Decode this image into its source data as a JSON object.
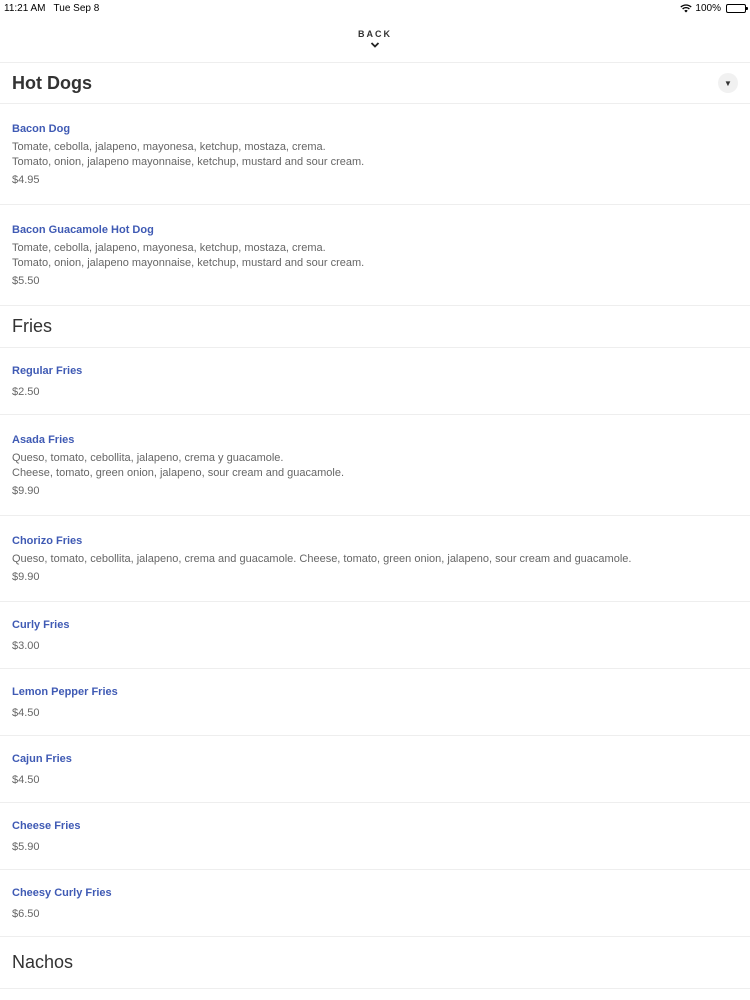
{
  "status": {
    "time": "11:21 AM",
    "date": "Tue Sep 8",
    "battery": "100%"
  },
  "nav": {
    "back_label": "BACK"
  },
  "sections": [
    {
      "title": "Hot Dogs",
      "items": [
        {
          "name": "Bacon Dog",
          "desc": [
            "Tomate, cebolla, jalapeno, mayonesa, ketchup, mostaza, crema.",
            "Tomato, onion, jalapeno mayonnaise, ketchup, mustard and sour cream."
          ],
          "price": "$4.95"
        },
        {
          "name": "Bacon Guacamole Hot Dog",
          "desc": [
            "Tomate, cebolla, jalapeno, mayonesa, ketchup, mostaza, crema.",
            "Tomato, onion, jalapeno mayonnaise, ketchup, mustard and sour cream."
          ],
          "price": "$5.50"
        }
      ]
    },
    {
      "title": "Fries",
      "items": [
        {
          "name": "Regular Fries",
          "price": "$2.50"
        },
        {
          "name": "Asada Fries",
          "desc": [
            "Queso, tomato, cebollita, jalapeno, crema y guacamole.",
            "Cheese, tomato, green onion, jalapeno, sour cream and guacamole."
          ],
          "price": "$9.90"
        },
        {
          "name": "Chorizo Fries",
          "desc": [
            "Queso, tomato, cebollita, jalapeno, crema and guacamole. Cheese, tomato, green onion, jalapeno, sour cream and guacamole."
          ],
          "price": "$9.90"
        },
        {
          "name": "Curly Fries",
          "price": "$3.00"
        },
        {
          "name": "Lemon Pepper Fries",
          "price": "$4.50"
        },
        {
          "name": "Cajun Fries",
          "price": "$4.50"
        },
        {
          "name": "Cheese Fries",
          "price": "$5.90"
        },
        {
          "name": "Cheesy Curly Fries",
          "price": "$6.50"
        }
      ]
    },
    {
      "title": "Nachos"
    }
  ]
}
